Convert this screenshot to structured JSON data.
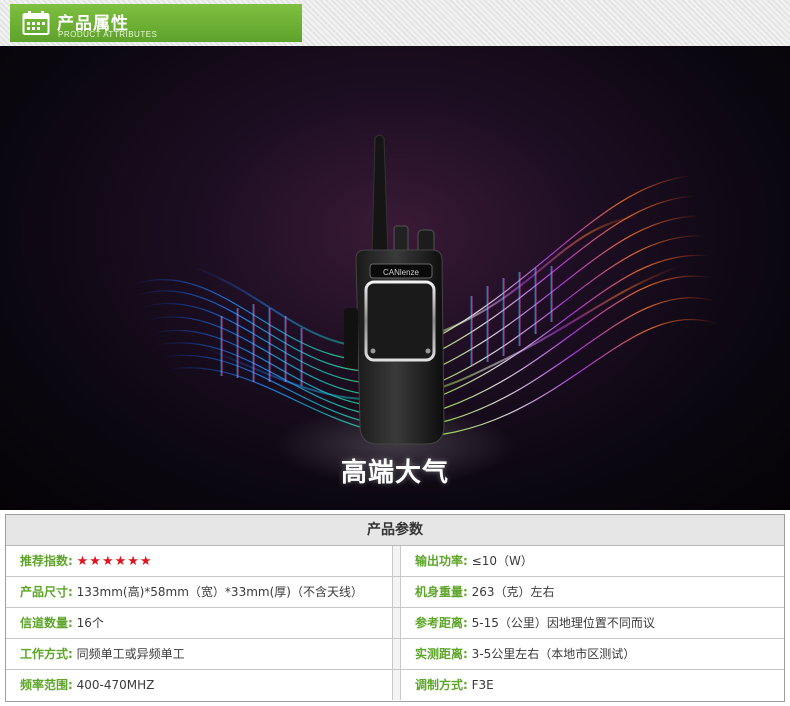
{
  "header": {
    "title": "产品属性",
    "subtitle": "PRODUCT ATTRIBUTES"
  },
  "banner": {
    "caption": "高端大气",
    "brand_label": "CANlenze"
  },
  "specs": {
    "title": "产品参数",
    "rows": [
      {
        "left_label": "推荐指数:",
        "left_value": "",
        "right_label": "输出功率:",
        "right_value": "≤10（W）"
      },
      {
        "left_label": "产品尺寸:",
        "left_value": "133mm(高)*58mm（宽）*33mm(厚)（不含天线）",
        "right_label": "机身重量:",
        "right_value": "263（克）左右"
      },
      {
        "left_label": "信道数量:",
        "left_value": "16个",
        "right_label": "参考距离:",
        "right_value": "5-15（公里）因地理位置不同而议"
      },
      {
        "left_label": "工作方式:",
        "left_value": "同频单工或异频单工",
        "right_label": "实测距离:",
        "right_value": "3-5公里左右（本地市区测试）"
      },
      {
        "left_label": "频率范围:",
        "left_value": "400-470MHZ",
        "right_label": "调制方式:",
        "right_value": "F3E"
      }
    ],
    "rating": {
      "stars": 6,
      "symbol": "★"
    }
  },
  "colors": {
    "accent_green": "#5ea52a",
    "star_red": "#e0141e"
  }
}
